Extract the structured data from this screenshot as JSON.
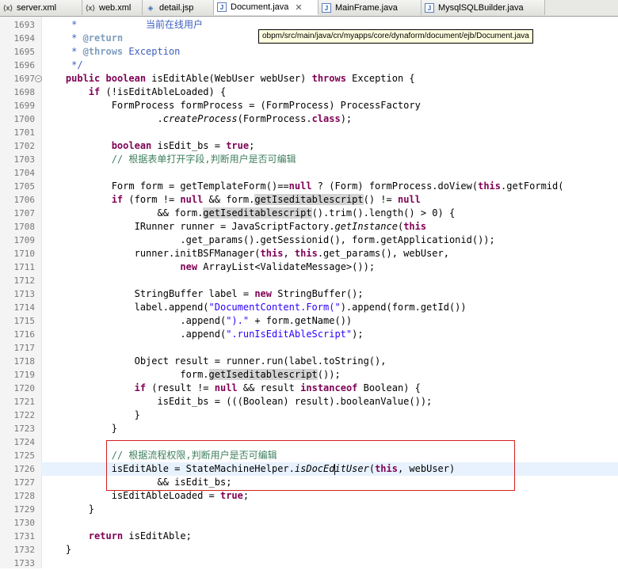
{
  "tabs": [
    {
      "label": "server.xml",
      "icon": "xml-file-icon",
      "active": false
    },
    {
      "label": "web.xml",
      "icon": "xml-file-icon",
      "active": false
    },
    {
      "label": "detail.jsp",
      "icon": "jsp-file-icon",
      "active": false
    },
    {
      "label": "Document.java",
      "icon": "java-file-icon",
      "active": true
    },
    {
      "label": "MainFrame.java",
      "icon": "java-file-icon",
      "active": false
    },
    {
      "label": "MysqlSQLBuilder.java",
      "icon": "java-file-icon",
      "active": false
    }
  ],
  "tooltip": "obpm/src/main/java/cn/myapps/core/dynaform/document/ejb/Document.java",
  "cursor_line": 1726,
  "colors": {
    "keyword": "#7f0055",
    "comment": "#3f7f5f",
    "javadoc": "#3f5fbf",
    "string": "#2a00ff",
    "highlight": "#e8f2fe",
    "red_box": "#d42020"
  },
  "lines": [
    {
      "n": "1693",
      "t": [
        {
          "c": "jd",
          "s": "     *            当前在线用户"
        }
      ]
    },
    {
      "n": "1694",
      "t": [
        {
          "c": "jd",
          "s": "     * "
        },
        {
          "c": "jt",
          "s": "@return"
        }
      ]
    },
    {
      "n": "1695",
      "t": [
        {
          "c": "jd",
          "s": "     * "
        },
        {
          "c": "jt",
          "s": "@throws"
        },
        {
          "c": "jd",
          "s": " Exception"
        }
      ]
    },
    {
      "n": "1696",
      "t": [
        {
          "c": "jd",
          "s": "     */"
        }
      ]
    },
    {
      "n": "1697",
      "fold": true,
      "t": [
        {
          "c": "",
          "s": "    "
        },
        {
          "c": "kw",
          "s": "public"
        },
        {
          "c": "",
          "s": " "
        },
        {
          "c": "kw",
          "s": "boolean"
        },
        {
          "c": "",
          "s": " isEditAble(WebUser webUser) "
        },
        {
          "c": "kw",
          "s": "throws"
        },
        {
          "c": "",
          "s": " Exception {"
        }
      ]
    },
    {
      "n": "1698",
      "t": [
        {
          "c": "",
          "s": "        "
        },
        {
          "c": "kw",
          "s": "if"
        },
        {
          "c": "",
          "s": " (!isEditAbleLoaded) {"
        }
      ]
    },
    {
      "n": "1699",
      "t": [
        {
          "c": "",
          "s": "            FormProcess formProcess = (FormProcess) ProcessFactory"
        }
      ]
    },
    {
      "n": "1700",
      "t": [
        {
          "c": "",
          "s": "                    ."
        },
        {
          "c": "it",
          "s": "createProcess"
        },
        {
          "c": "",
          "s": "(FormProcess."
        },
        {
          "c": "kw",
          "s": "class"
        },
        {
          "c": "",
          "s": ");"
        }
      ]
    },
    {
      "n": "1701",
      "t": []
    },
    {
      "n": "1702",
      "t": [
        {
          "c": "",
          "s": "            "
        },
        {
          "c": "kw",
          "s": "boolean"
        },
        {
          "c": "",
          "s": " isEdit_bs = "
        },
        {
          "c": "kw",
          "s": "true"
        },
        {
          "c": "",
          "s": ";"
        }
      ]
    },
    {
      "n": "1703",
      "t": [
        {
          "c": "",
          "s": "            "
        },
        {
          "c": "cm",
          "s": "// 根据表单打开字段,判断用户是否可编辑"
        }
      ]
    },
    {
      "n": "1704",
      "t": []
    },
    {
      "n": "1705",
      "t": [
        {
          "c": "",
          "s": "            Form form = getTemplateForm()=="
        },
        {
          "c": "kw",
          "s": "null"
        },
        {
          "c": "",
          "s": " ? (Form) formProcess.doView("
        },
        {
          "c": "kw",
          "s": "this"
        },
        {
          "c": "",
          "s": ".getFormid("
        }
      ]
    },
    {
      "n": "1706",
      "t": [
        {
          "c": "",
          "s": "            "
        },
        {
          "c": "kw",
          "s": "if"
        },
        {
          "c": "",
          "s": " (form != "
        },
        {
          "c": "kw",
          "s": "null"
        },
        {
          "c": "",
          "s": " && form."
        },
        {
          "c": "oc",
          "s": "getIseditablescript"
        },
        {
          "c": "",
          "s": "() != "
        },
        {
          "c": "kw",
          "s": "null"
        }
      ]
    },
    {
      "n": "1707",
      "t": [
        {
          "c": "",
          "s": "                    && form."
        },
        {
          "c": "oc",
          "s": "getIseditablescript"
        },
        {
          "c": "",
          "s": "().trim().length() > 0) {"
        }
      ]
    },
    {
      "n": "1708",
      "t": [
        {
          "c": "",
          "s": "                IRunner runner = JavaScriptFactory."
        },
        {
          "c": "it",
          "s": "getInstance"
        },
        {
          "c": "",
          "s": "("
        },
        {
          "c": "kw",
          "s": "this"
        }
      ]
    },
    {
      "n": "1709",
      "t": [
        {
          "c": "",
          "s": "                        .get_params().getSessionid(), form.getApplicationid());"
        }
      ]
    },
    {
      "n": "1710",
      "t": [
        {
          "c": "",
          "s": "                runner.initBSFManager("
        },
        {
          "c": "kw",
          "s": "this"
        },
        {
          "c": "",
          "s": ", "
        },
        {
          "c": "kw",
          "s": "this"
        },
        {
          "c": "",
          "s": ".get_params(), webUser,"
        }
      ]
    },
    {
      "n": "1711",
      "t": [
        {
          "c": "",
          "s": "                        "
        },
        {
          "c": "kw",
          "s": "new"
        },
        {
          "c": "",
          "s": " ArrayList<ValidateMessage>());"
        }
      ]
    },
    {
      "n": "1712",
      "t": []
    },
    {
      "n": "1713",
      "t": [
        {
          "c": "",
          "s": "                StringBuffer label = "
        },
        {
          "c": "kw",
          "s": "new"
        },
        {
          "c": "",
          "s": " StringBuffer();"
        }
      ]
    },
    {
      "n": "1714",
      "t": [
        {
          "c": "",
          "s": "                label.append("
        },
        {
          "c": "st",
          "s": "\"DocumentContent.Form(\""
        },
        {
          "c": "",
          "s": ").append(form.getId())"
        }
      ]
    },
    {
      "n": "1715",
      "t": [
        {
          "c": "",
          "s": "                        .append("
        },
        {
          "c": "st",
          "s": "\").\""
        },
        {
          "c": "",
          "s": " + form.getName())"
        }
      ]
    },
    {
      "n": "1716",
      "t": [
        {
          "c": "",
          "s": "                        .append("
        },
        {
          "c": "st",
          "s": "\".runIsEditAbleScript\""
        },
        {
          "c": "",
          "s": ");"
        }
      ]
    },
    {
      "n": "1717",
      "t": []
    },
    {
      "n": "1718",
      "t": [
        {
          "c": "",
          "s": "                Object result = runner.run(label.toString(),"
        }
      ]
    },
    {
      "n": "1719",
      "t": [
        {
          "c": "",
          "s": "                        form."
        },
        {
          "c": "oc",
          "s": "getIseditablescript"
        },
        {
          "c": "",
          "s": "());"
        }
      ]
    },
    {
      "n": "1720",
      "t": [
        {
          "c": "",
          "s": "                "
        },
        {
          "c": "kw",
          "s": "if"
        },
        {
          "c": "",
          "s": " (result != "
        },
        {
          "c": "kw",
          "s": "null"
        },
        {
          "c": "",
          "s": " && result "
        },
        {
          "c": "kw",
          "s": "instanceof"
        },
        {
          "c": "",
          "s": " Boolean) {"
        }
      ]
    },
    {
      "n": "1721",
      "t": [
        {
          "c": "",
          "s": "                    isEdit_bs = (((Boolean) result).booleanValue());"
        }
      ]
    },
    {
      "n": "1722",
      "t": [
        {
          "c": "",
          "s": "                }"
        }
      ]
    },
    {
      "n": "1723",
      "t": [
        {
          "c": "",
          "s": "            }"
        }
      ]
    },
    {
      "n": "1724",
      "t": []
    },
    {
      "n": "1725",
      "t": [
        {
          "c": "",
          "s": "            "
        },
        {
          "c": "cm",
          "s": "// 根据流程权限,判断用户是否可编辑"
        }
      ]
    },
    {
      "n": "1726",
      "t": [
        {
          "c": "",
          "s": "            isEditAble = StateMachineHelper."
        },
        {
          "c": "it",
          "s": "isDocEd"
        },
        {
          "c": "caret",
          "s": ""
        },
        {
          "c": "it",
          "s": "itUser"
        },
        {
          "c": "",
          "s": "("
        },
        {
          "c": "kw",
          "s": "this"
        },
        {
          "c": "",
          "s": ", webUser)"
        }
      ]
    },
    {
      "n": "1727",
      "t": [
        {
          "c": "",
          "s": "                    && isEdit_bs;"
        }
      ]
    },
    {
      "n": "1728",
      "t": [
        {
          "c": "",
          "s": "            isEditAbleLoaded = "
        },
        {
          "c": "kw",
          "s": "true"
        },
        {
          "c": "",
          "s": ";"
        }
      ]
    },
    {
      "n": "1729",
      "t": [
        {
          "c": "",
          "s": "        }"
        }
      ]
    },
    {
      "n": "1730",
      "t": []
    },
    {
      "n": "1731",
      "t": [
        {
          "c": "",
          "s": "        "
        },
        {
          "c": "kw",
          "s": "return"
        },
        {
          "c": "",
          "s": " isEditAble;"
        }
      ]
    },
    {
      "n": "1732",
      "t": [
        {
          "c": "",
          "s": "    }"
        }
      ]
    },
    {
      "n": "1733",
      "t": []
    }
  ]
}
